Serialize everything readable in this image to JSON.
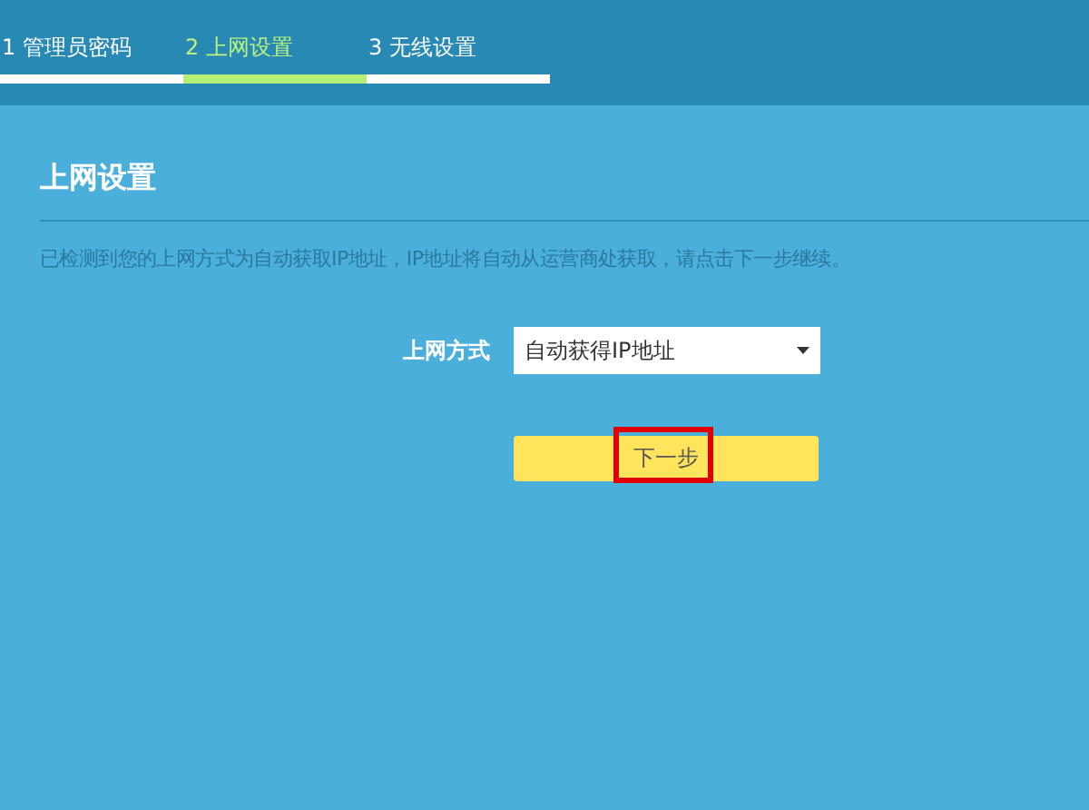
{
  "steps": [
    {
      "label": "1 管理员密码",
      "selected": false
    },
    {
      "label": "2 上网设置",
      "selected": true
    },
    {
      "label": "3 无线设置",
      "selected": false
    }
  ],
  "section": {
    "title": "上网设置",
    "description": "已检测到您的上网方式为自动获取IP地址，IP地址将自动从运营商处获取，请点击下一步继续。"
  },
  "form": {
    "label": "上网方式",
    "value": "自动获得IP地址"
  },
  "next_button": {
    "label": "下一步",
    "highlighted": true
  }
}
